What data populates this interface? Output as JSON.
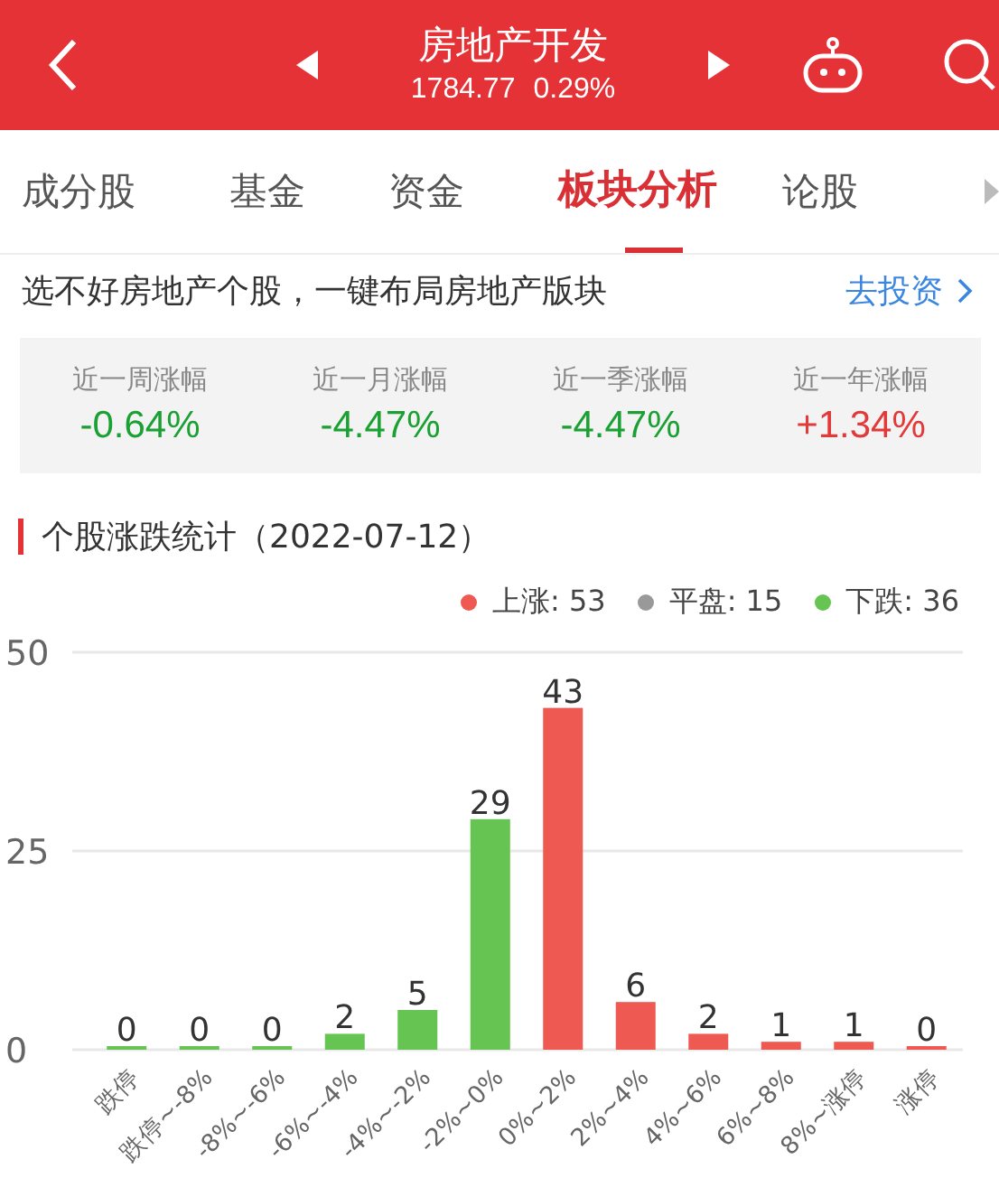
{
  "header": {
    "title": "房地产开发",
    "index_value": "1784.77",
    "change": "0.29%"
  },
  "tabs": [
    {
      "label": "成分股",
      "selected": false
    },
    {
      "label": "基金",
      "selected": false
    },
    {
      "label": "资金",
      "selected": false
    },
    {
      "label": "板块分析",
      "selected": true
    },
    {
      "label": "论股",
      "selected": false
    }
  ],
  "promo": {
    "text": "选不好房地产个股，一键布局房地产版块",
    "link": "去投资"
  },
  "stats": [
    {
      "label": "近一周涨幅",
      "value": "-0.64%",
      "kind": "down"
    },
    {
      "label": "近一月涨幅",
      "value": "-4.47%",
      "kind": "down"
    },
    {
      "label": "近一季涨幅",
      "value": "-4.47%",
      "kind": "down"
    },
    {
      "label": "近一年涨幅",
      "value": "+1.34%",
      "kind": "up"
    }
  ],
  "section_title": "个股涨跌统计（2022-07-12）",
  "legend": [
    {
      "label": "上涨: 53",
      "color": "#ee5a52"
    },
    {
      "label": "平盘: 15",
      "color": "#999999"
    },
    {
      "label": "下跌: 36",
      "color": "#66c452"
    }
  ],
  "chart": {
    "chart_data": {
      "type": "bar",
      "categories": [
        "跌停",
        "跌停~-8%",
        "-8%~-6%",
        "-6%~-4%",
        "-4%~-2%",
        "-2%~0%",
        "0%~2%",
        "2%~4%",
        "4%~6%",
        "6%~8%",
        "8%~涨停",
        "涨停"
      ],
      "series": [
        {
          "color": "#66c452",
          "values": [
            0,
            0,
            0,
            2,
            5,
            29,
            null,
            null,
            null,
            null,
            null,
            null
          ]
        },
        {
          "color": "#ee5a52",
          "values": [
            null,
            null,
            null,
            null,
            null,
            null,
            43,
            6,
            2,
            1,
            1,
            0
          ]
        }
      ],
      "stacked": true,
      "ylim": [
        0,
        50
      ],
      "yticks": [
        0,
        25,
        50
      ],
      "data_labels": true
    }
  }
}
